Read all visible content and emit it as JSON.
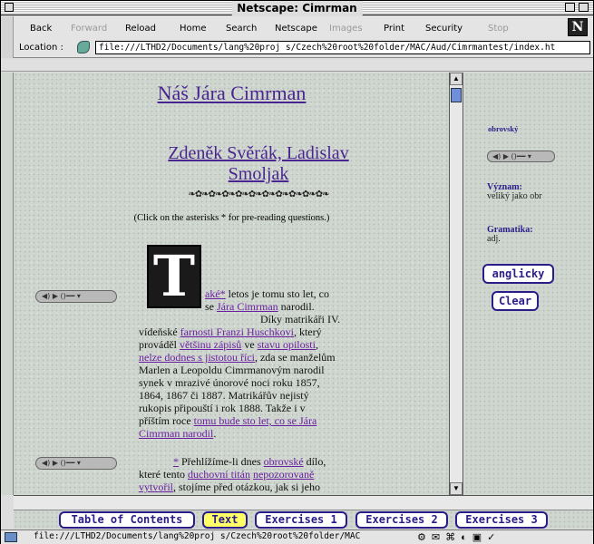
{
  "window": {
    "title": "Netscape: Cimrman"
  },
  "toolbar": {
    "buttons": [
      {
        "label": "Back",
        "enabled": true
      },
      {
        "label": "Forward",
        "enabled": false
      },
      {
        "label": "Reload",
        "enabled": true
      },
      {
        "label": "Home",
        "enabled": true
      },
      {
        "label": "Search",
        "enabled": true
      },
      {
        "label": "Netscape",
        "enabled": true
      },
      {
        "label": "Images",
        "enabled": false
      },
      {
        "label": "Print",
        "enabled": true
      },
      {
        "label": "Security",
        "enabled": true
      },
      {
        "label": "Stop",
        "enabled": false
      }
    ],
    "logo": "N"
  },
  "location": {
    "label": "Location :",
    "url": "file:///LTHD2/Documents/lang%20proj s/Czech%20root%20folder/MAC/Aud/Cimrmantest/index.ht"
  },
  "content": {
    "title": "Náš Jára Cimrman",
    "authors": "Zdeněk Svěrák, Ladislav Smoljak",
    "decoration": "❧✿❧✿❧✿❧✿❧✿❧✿❧✿❧✿❧✿❧✿❧",
    "note": "(Click on the asterisks * for pre-reading questions.)",
    "player_label": "◀) ▶ ()━━ ▾",
    "dropcap": "T",
    "para1": {
      "link1": "aké*",
      "t1": " letos je tomu sto let, co",
      "t2": "se ",
      "link2": "Jára Cimrman",
      "t3": " narodil.",
      "t4": "Díky matrikáři IV.",
      "t5": "vídeňské ",
      "link3": "farnosti Franzi Huschkovi",
      "t6": ", který",
      "t7": "prováděl ",
      "link4": "většinu zápisů",
      "t8": " ve ",
      "link5": "stavu opilosti",
      "t9": ",",
      "link6": "nelze dodnes s jistotou říci",
      "t10": ", zda se manželům",
      "t11": "Marlen a Leopoldu Cimrmanovým narodil",
      "t12": "synek v mrazivé únorové noci roku 1857,",
      "t13": "1864, 1867 či 1887. Matrikářův nejistý",
      "t14": "rukopis připouští i rok 1888. Takže i v",
      "t15": "příštím roce ",
      "link7": "tomu bude sto let, co se Jára",
      "link8": "Cimrman narodil",
      "t16": "."
    },
    "para2": {
      "link1": "*",
      "t1": " Přehlížíme-li dnes ",
      "link2": "obrovské",
      "t2": " dílo,",
      "t3": "které tento ",
      "link3": "duchovní titán",
      "t4": " ",
      "link4": "nepozorovaně",
      "link5": "vytvořil",
      "t5": ", stojíme před otázkou, jak si jeho"
    }
  },
  "sidebar": {
    "word": "obrovský",
    "meaning_label": "Význam:",
    "meaning_value": "veliký jako obr",
    "grammar_label": "Gramatika:",
    "grammar_value": "adj.",
    "btn_english": "anglicky",
    "btn_clear": "Clear"
  },
  "nav": {
    "items": [
      {
        "label": "Table of Contents",
        "active": false
      },
      {
        "label": "Text",
        "active": true
      },
      {
        "label": "Exercises 1",
        "active": false
      },
      {
        "label": "Exercises 2",
        "active": false
      },
      {
        "label": "Exercises 3",
        "active": false
      }
    ]
  },
  "status": {
    "text": "file:///LTHD2/Documents/lang%20proj s/Czech%20root%20folder/MAC",
    "tray": "⚙✉⌘◐▣✓"
  }
}
